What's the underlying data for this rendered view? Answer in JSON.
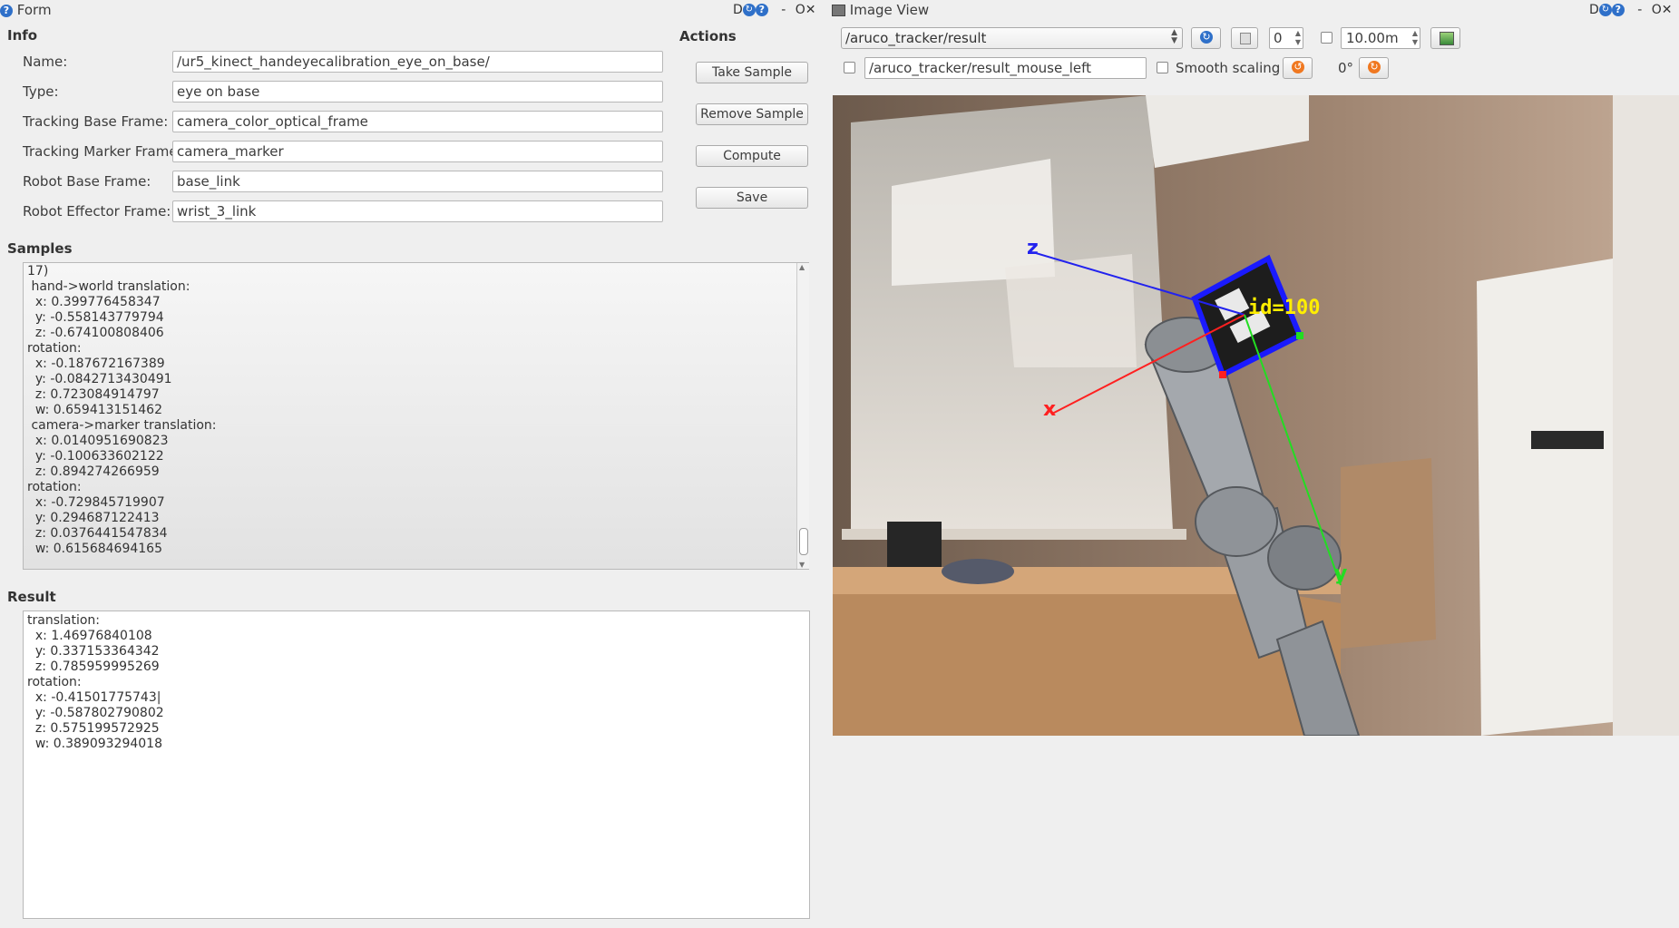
{
  "form": {
    "title": "Form",
    "info_label": "Info",
    "actions_label": "Actions",
    "fields": [
      {
        "label": "Name:",
        "value": "/ur5_kinect_handeyecalibration_eye_on_base/"
      },
      {
        "label": "Type:",
        "value": "eye on base"
      },
      {
        "label": "Tracking Base Frame:",
        "value": "camera_color_optical_frame"
      },
      {
        "label": "Tracking Marker Frame:",
        "value": "camera_marker"
      },
      {
        "label": "Robot Base Frame:",
        "value": "base_link"
      },
      {
        "label": "Robot Effector Frame:",
        "value": "wrist_3_link"
      }
    ],
    "buttons": {
      "take_sample": "Take Sample",
      "remove_sample": "Remove Sample",
      "compute": "Compute",
      "save": "Save"
    },
    "samples_label": "Samples",
    "samples_text": "17)\n hand->world translation:\n  x: 0.399776458347\n  y: -0.558143779794\n  z: -0.674100808406\nrotation:\n  x: -0.187672167389\n  y: -0.0842713430491\n  z: 0.723084914797\n  w: 0.659413151462\n camera->marker translation:\n  x: 0.0140951690823\n  y: -0.100633602122\n  z: 0.894274266959\nrotation:\n  x: -0.729845719907\n  y: 0.294687122413\n  z: 0.0376441547834\n  w: 0.615684694165",
    "result_label": "Result",
    "result_text": "translation:\n  x: 1.46976840108\n  y: 0.337153364342\n  z: 0.785959995269\nrotation:\n  x: -0.41501775743|\n  y: -0.587802790802\n  z: 0.575199572925\n  w: 0.389093294018"
  },
  "image_view": {
    "title": "Image View",
    "topic": "/aruco_tracker/result",
    "spin_value": "0",
    "distance": "10.00m",
    "mouse_topic": "/aruco_tracker/result_mouse_left",
    "smooth_scaling": "Smooth scaling",
    "rotation": "0°",
    "overlay": {
      "marker_id": "id=100",
      "axis_z": "z",
      "axis_x": "x",
      "axis_y": "y"
    }
  },
  "title_ctl": {
    "d": "D",
    "dash": "-",
    "o": "O",
    "close": "✕"
  },
  "colors": {
    "accent": "#2f70c9",
    "axis_x": "#ff2020",
    "axis_y": "#22dd22",
    "axis_z": "#2020ee",
    "marker_label": "#ffee00"
  }
}
